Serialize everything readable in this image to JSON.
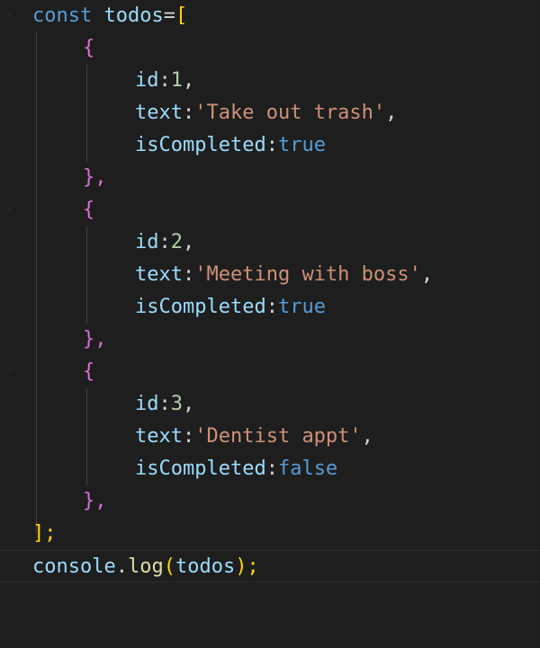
{
  "lines": [
    {
      "keyword": "const",
      "name": "todos",
      "op": "=",
      "bracket": "["
    },
    {
      "text": "{"
    },
    {
      "key": "id",
      "colon": ":",
      "value": "1",
      "comma": ","
    },
    {
      "key": "text",
      "colon": ":",
      "value": "'Take out trash'",
      "comma": ","
    },
    {
      "key": "isCompleted",
      "colon": ":",
      "value": "true"
    },
    {
      "text": "},"
    },
    {
      "text": "{"
    },
    {
      "key": "id",
      "colon": ":",
      "value": "2",
      "comma": ","
    },
    {
      "key": "text",
      "colon": ":",
      "value": "'Meeting with boss'",
      "comma": ","
    },
    {
      "key": "isCompleted",
      "colon": ":",
      "value": "true"
    },
    {
      "text": "},"
    },
    {
      "text": "{"
    },
    {
      "key": "id",
      "colon": ":",
      "value": "3",
      "comma": ","
    },
    {
      "key": "text",
      "colon": ":",
      "value": "'Dentist appt'",
      "comma": ","
    },
    {
      "key": "isCompleted",
      "colon": ":",
      "value": "false"
    },
    {
      "text": "},"
    },
    {
      "text": "];"
    },
    {
      "object": "console",
      "dot": ".",
      "method": "log",
      "open": "(",
      "arg": "todos",
      "close": ");"
    }
  ],
  "colors": {
    "background": "#1e1e1e",
    "keyword": "#569cd6",
    "variable": "#9cdcfe",
    "string": "#ce9178",
    "number": "#b5cea8",
    "function": "#dcdcaa",
    "bracket_outer": "#ffd700",
    "bracket_inner": "#da70d6"
  },
  "gutter": {
    "fold_icons": [
      "chevron-down-icon",
      "chevron-down-icon",
      "chevron-down-icon"
    ]
  }
}
